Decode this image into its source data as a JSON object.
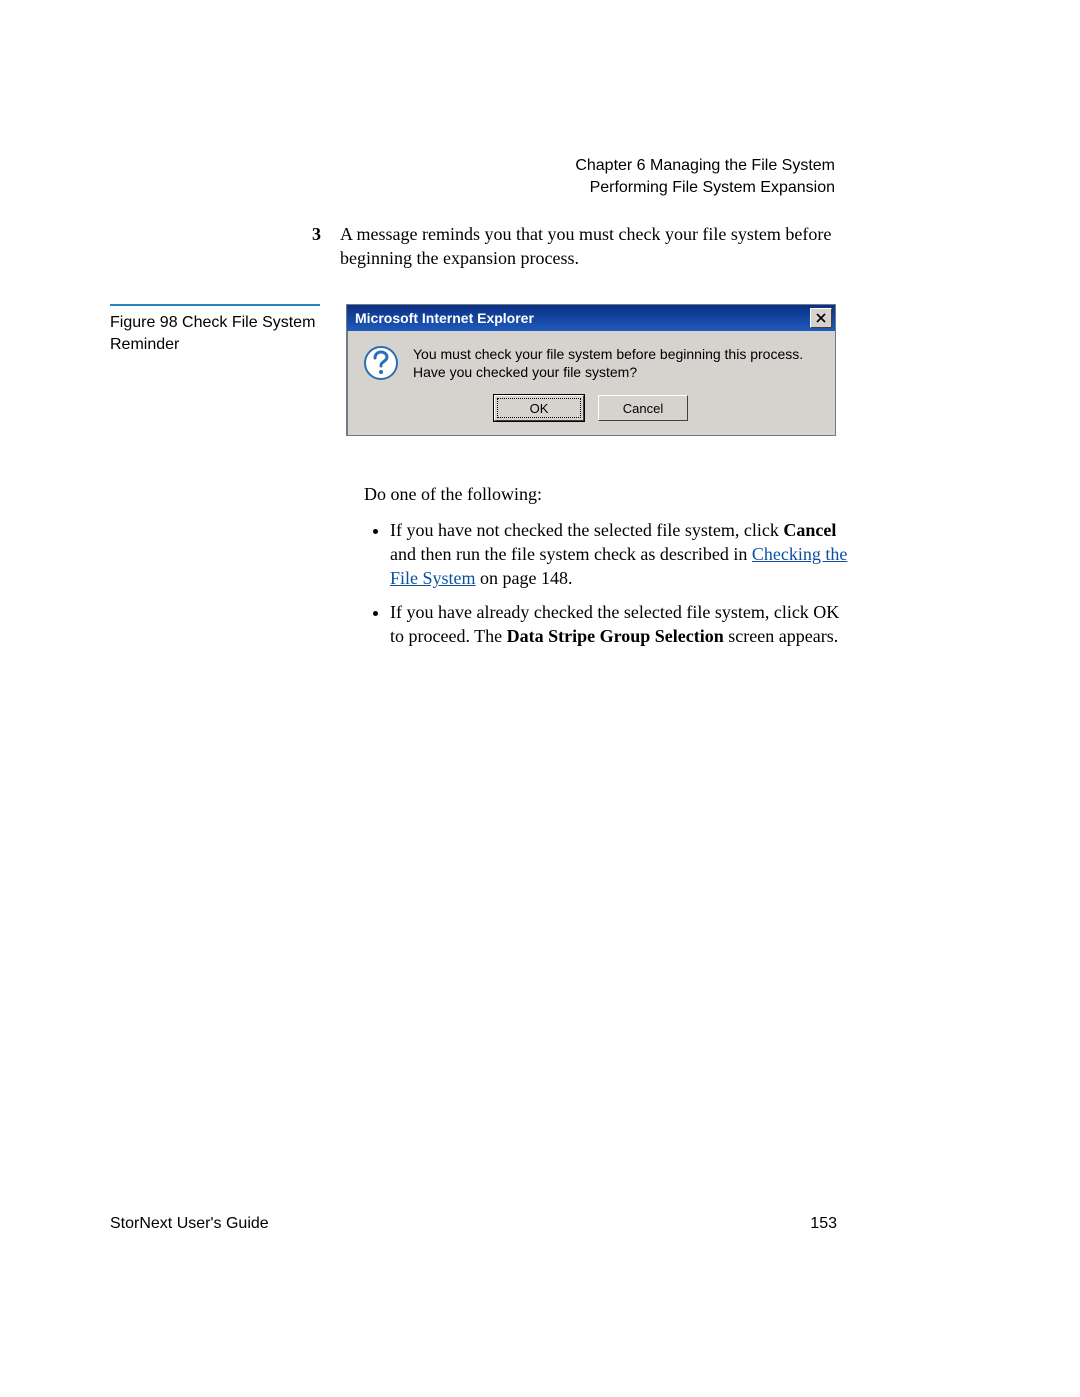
{
  "header": {
    "chapter": "Chapter 6  Managing the File System",
    "section": "Performing File System Expansion"
  },
  "step": {
    "number": "3",
    "text": "A message reminds you that you must check your file system before beginning the expansion process."
  },
  "figure": {
    "label": "Figure 98  Check File System Reminder"
  },
  "dialog": {
    "title": "Microsoft Internet Explorer",
    "line1": "You must check your file system before beginning this process.",
    "line2": "Have you checked your file system?",
    "ok": "OK",
    "cancel": "Cancel"
  },
  "body": {
    "intro": "Do one of the following:",
    "b1_a": "If you have not checked the selected file system, click ",
    "b1_cancel": "Cancel",
    "b1_b": " and then run the file system check as described in ",
    "b1_link": "Checking the File System",
    "b1_c": " on page  148.",
    "b2_a": "If you have already checked the selected file system, click OK to proceed. The ",
    "b2_bold": "Data Stripe Group Selection",
    "b2_b": " screen appears."
  },
  "footer": {
    "guide": "StorNext User's Guide",
    "page": "153"
  }
}
